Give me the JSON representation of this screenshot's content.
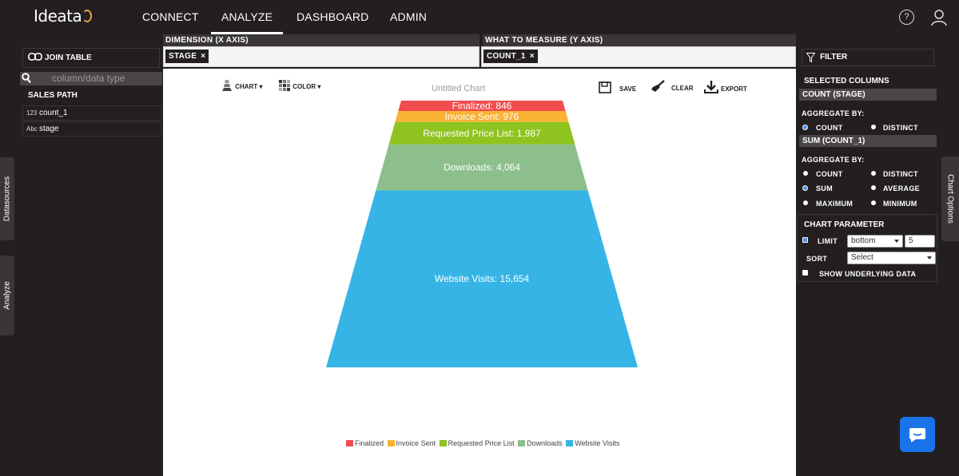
{
  "app": {
    "logo": "Ideata"
  },
  "nav": {
    "items": [
      "CONNECT",
      "ANALYZE",
      "DASHBOARD",
      "ADMIN"
    ],
    "active": "ANALYZE"
  },
  "axes": {
    "x_label": "DIMENSION (X AXIS)",
    "x_pill": "STAGE",
    "y_label": "WHAT TO MEASURE (Y AXIS)",
    "y_pill": "COUNT_1",
    "remove": "×"
  },
  "left": {
    "join_table": "JOIN TABLE",
    "search_placeholder": "column/data type",
    "section": "SALES PATH",
    "columns": [
      {
        "icon": "123",
        "name": "count_1"
      },
      {
        "icon": "Abc",
        "name": "stage"
      }
    ],
    "tab_datasources": "Datasources",
    "tab_analyze": "Analyze"
  },
  "toolbar": {
    "chart": "CHART",
    "color": "COLOR",
    "save": "SAVE",
    "clear": "CLEAR",
    "export": "EXPORT"
  },
  "chart_data": {
    "type": "funnel",
    "title": "Untitled Chart",
    "categories": [
      "Finalized",
      "Invoice Sent",
      "Requested Price List",
      "Downloads",
      "Website Visits"
    ],
    "values": [
      846,
      976,
      1987,
      4064,
      15654
    ],
    "labels": [
      "Finalized: 846",
      "Invoice Sent: 976",
      "Requested Price List: 1,987",
      "Downloads: 4,064",
      "Website Visits: 15,654"
    ],
    "colors": [
      "#f04e4e",
      "#f9b233",
      "#8fc31f",
      "#8cbf8c",
      "#36b4e5"
    ],
    "legend": "bottom"
  },
  "right": {
    "filter": "FILTER",
    "selected_columns": "SELECTED COLUMNS",
    "count_section": "COUNT (STAGE)",
    "sum_section": "SUM (COUNT_1)",
    "aggregate_by": "AGGREGATE BY:",
    "opt_count": "COUNT",
    "opt_distinct": "DISTINCT",
    "opt_sum": "SUM",
    "opt_average": "AVERAGE",
    "opt_maximum": "MAXIMUM",
    "opt_minimum": "MINIMUM",
    "chart_parameter": "CHART PARAMETER",
    "limit_label": "LIMIT",
    "limit_mode": "bottom",
    "limit_value": "5",
    "sort_label": "SORT",
    "sort_value": "Select",
    "show_underlying": "SHOW UNDERLYING DATA",
    "tab_chart_options": "Chart Options"
  }
}
